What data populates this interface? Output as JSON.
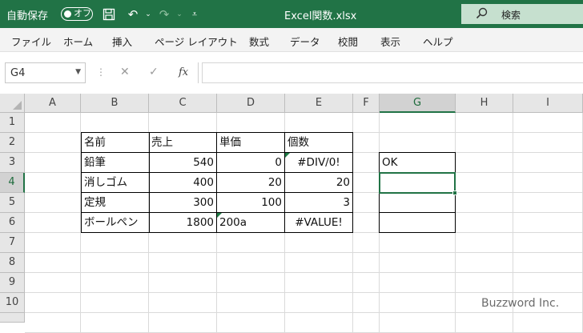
{
  "titlebar": {
    "autosave_label": "自動保存",
    "autosave_state": "オフ",
    "filename": "Excel関数.xlsx",
    "search_label": "検索",
    "bg_color": "#217346"
  },
  "ribbon": {
    "tabs": [
      "ファイル",
      "ホーム",
      "挿入",
      "ページ レイアウト",
      "数式",
      "データ",
      "校閲",
      "表示",
      "ヘルプ"
    ]
  },
  "formula_bar": {
    "name_box": "G4",
    "fx_label": "fx",
    "formula": ""
  },
  "sheet": {
    "columns": [
      "A",
      "B",
      "C",
      "D",
      "E",
      "F",
      "G",
      "H",
      "I"
    ],
    "rows": [
      "1",
      "2",
      "3",
      "4",
      "5",
      "6",
      "7",
      "8",
      "9",
      "10"
    ],
    "selected_cell": "G4",
    "table": {
      "headers": [
        "名前",
        "売上",
        "単価",
        "個数"
      ],
      "rows": [
        [
          "鉛筆",
          "540",
          "0",
          "#DIV/0!"
        ],
        [
          "消しゴム",
          "400",
          "20",
          "20"
        ],
        [
          "定規",
          "300",
          "100",
          "3"
        ],
        [
          "ボールペン",
          "1800",
          "200a",
          "#VALUE!"
        ]
      ]
    },
    "g_cells": [
      "OK",
      "",
      "",
      ""
    ]
  },
  "watermark": "Buzzword Inc."
}
